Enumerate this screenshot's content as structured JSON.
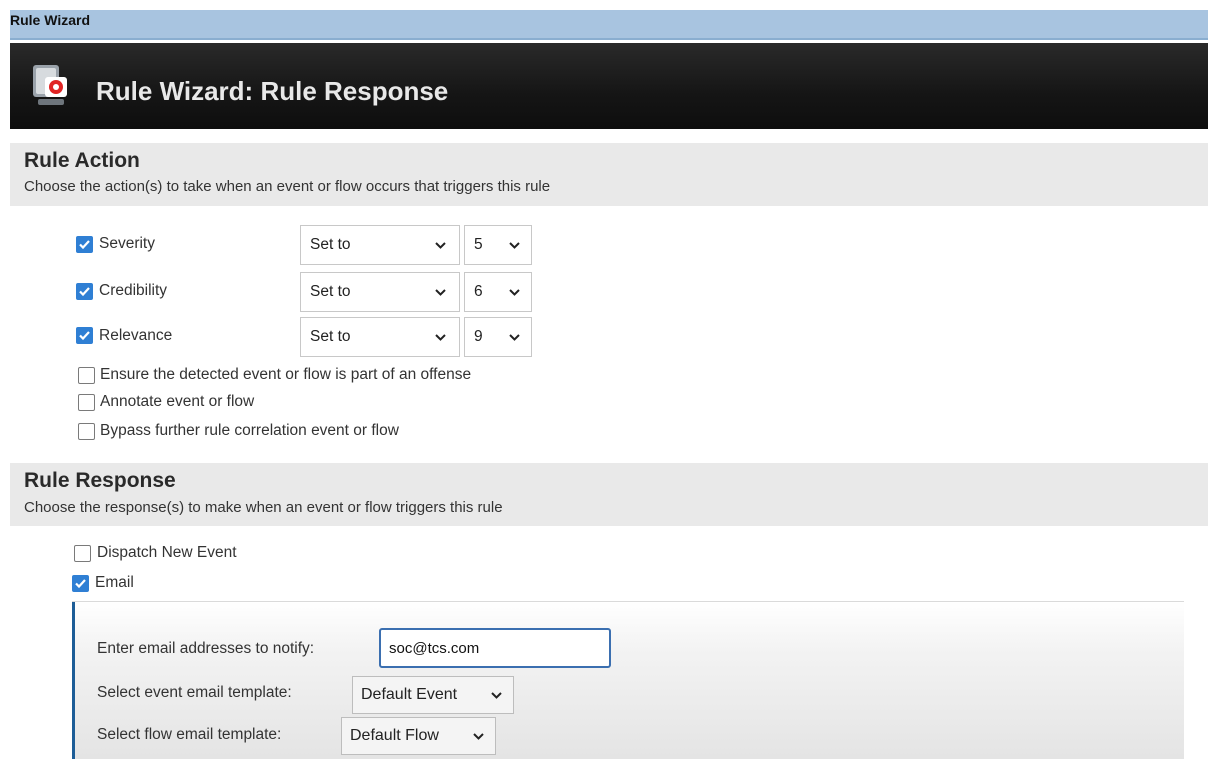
{
  "window": {
    "title": "Rule Wizard"
  },
  "banner": {
    "title": "Rule Wizard: Rule Response",
    "icon": "rule-wizard-icon"
  },
  "rule_action": {
    "heading": "Rule Action",
    "subtitle": "Choose the action(s) to take when an event or flow occurs that triggers this rule",
    "rows": [
      {
        "label": "Severity",
        "checked": true,
        "operator": "Set to",
        "value": "5"
      },
      {
        "label": "Credibility",
        "checked": true,
        "operator": "Set to",
        "value": "6"
      },
      {
        "label": "Relevance",
        "checked": true,
        "operator": "Set to",
        "value": "9"
      }
    ],
    "options": [
      {
        "label": "Ensure the detected event or flow is part of an offense",
        "checked": false
      },
      {
        "label": "Annotate event or flow",
        "checked": false
      },
      {
        "label": "Bypass further rule correlation event or flow",
        "checked": false
      }
    ]
  },
  "rule_response": {
    "heading": "Rule Response",
    "subtitle": "Choose the response(s) to make when an event or flow triggers this rule",
    "options": [
      {
        "label": "Dispatch New Event",
        "checked": false
      },
      {
        "label": "Email",
        "checked": true
      }
    ],
    "email": {
      "address_label": "Enter email addresses to notify:",
      "address_value": "soc@tcs.com",
      "event_template_label": "Select event email template:",
      "event_template_value": "Default Event",
      "flow_template_label": "Select flow email template:",
      "flow_template_value": "Default Flow"
    }
  },
  "colors": {
    "accent": "#2f7fd4",
    "titlebar": "#a8c4e0",
    "banner": "#151515",
    "section": "#e9e9e9"
  }
}
